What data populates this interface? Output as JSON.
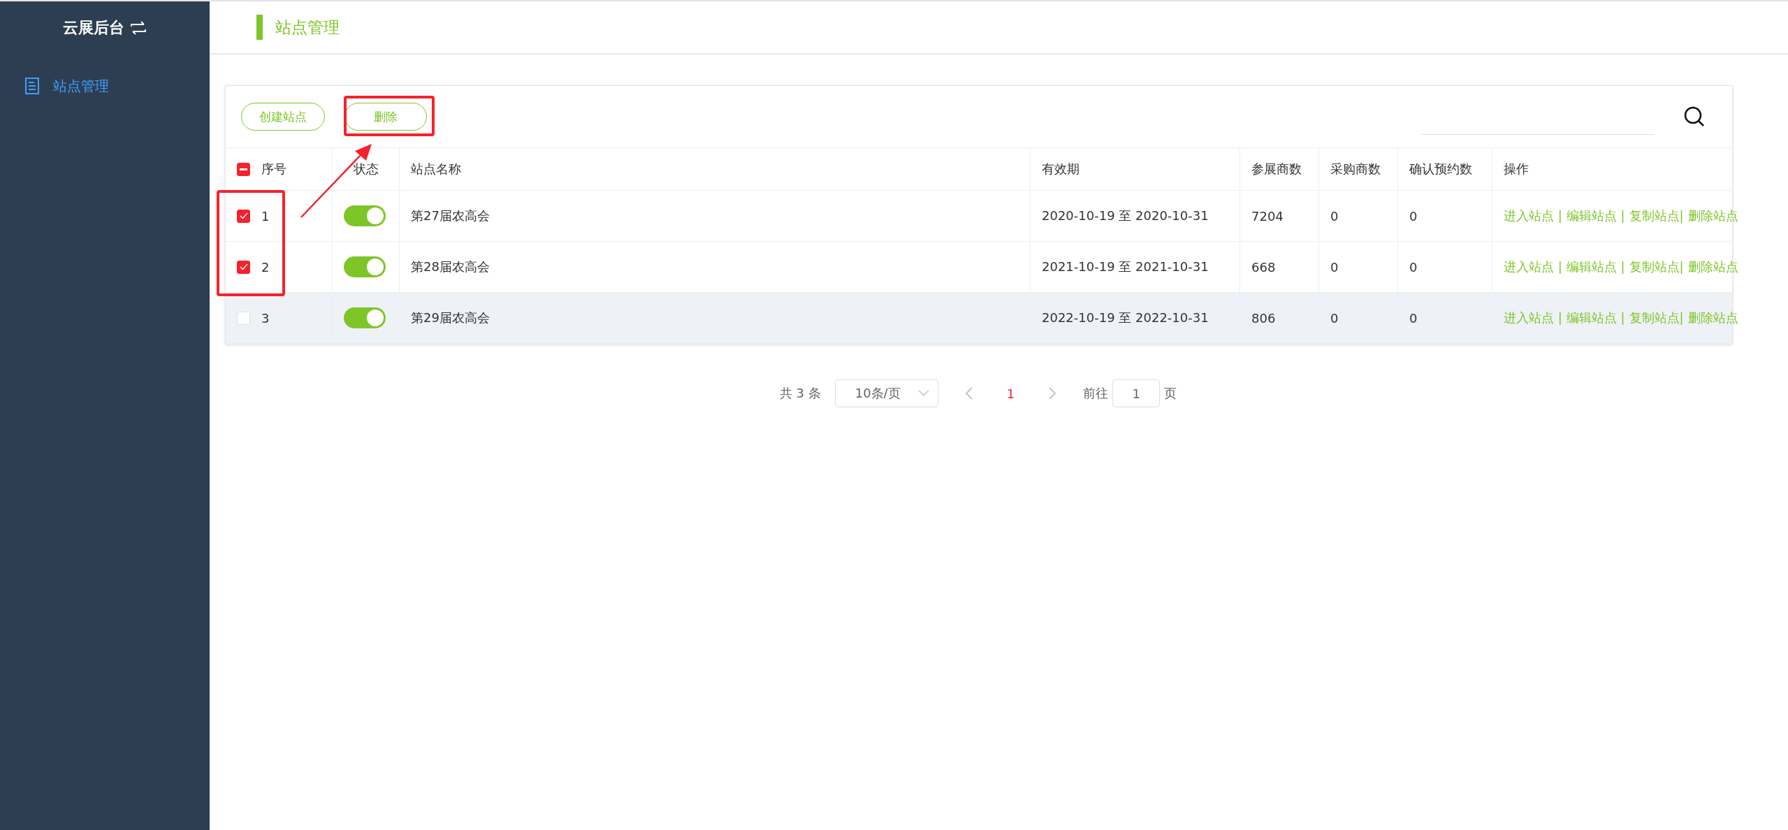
{
  "sidebar": {
    "title": "云展后台",
    "items": [
      {
        "label": "站点管理",
        "selected": true
      }
    ]
  },
  "header": {
    "title": "站点管理"
  },
  "toolbar": {
    "buttons": [
      "创建站点",
      "删除"
    ]
  },
  "table": {
    "select_all": {
      "indeterminate": true
    },
    "columns": [
      "序号",
      "状态",
      "站点名称",
      "有效期",
      "参展商数",
      "采购商数",
      "确认预约数",
      "操作"
    ],
    "rows": [
      {
        "index": "1",
        "checked": true,
        "on": true,
        "highlighted": false,
        "name": "第27届农高会",
        "validity": "2020-10-19 至 2020-10-31",
        "exhibitors": "7204",
        "buyers": "0",
        "confirmed": "0",
        "actions": [
          "进入站点 |",
          "编辑站点 |",
          "复制站点|",
          "删除站点"
        ]
      },
      {
        "index": "2",
        "checked": true,
        "on": true,
        "highlighted": false,
        "name": "第28届农高会",
        "validity": "2021-10-19 至 2021-10-31",
        "exhibitors": "668",
        "buyers": "0",
        "confirmed": "0",
        "actions": [
          "进入站点 |",
          "编辑站点 |",
          "复制站点|",
          "删除站点"
        ]
      },
      {
        "index": "3",
        "checked": false,
        "on": true,
        "highlighted": true,
        "name": "第29届农高会",
        "validity": "2022-10-19 至 2022-10-31",
        "exhibitors": "806",
        "buyers": "0",
        "confirmed": "0",
        "actions": [
          "进入站点 |",
          "编辑站点 |",
          "复制站点|",
          "删除站点"
        ]
      }
    ]
  },
  "pagination": {
    "total": "共 3 条",
    "page_size": "10条/页",
    "pages": [
      {
        "label": "1",
        "selected": true
      }
    ],
    "goto_label": "前往",
    "goto_value": "1",
    "goto_suffix": "页"
  }
}
